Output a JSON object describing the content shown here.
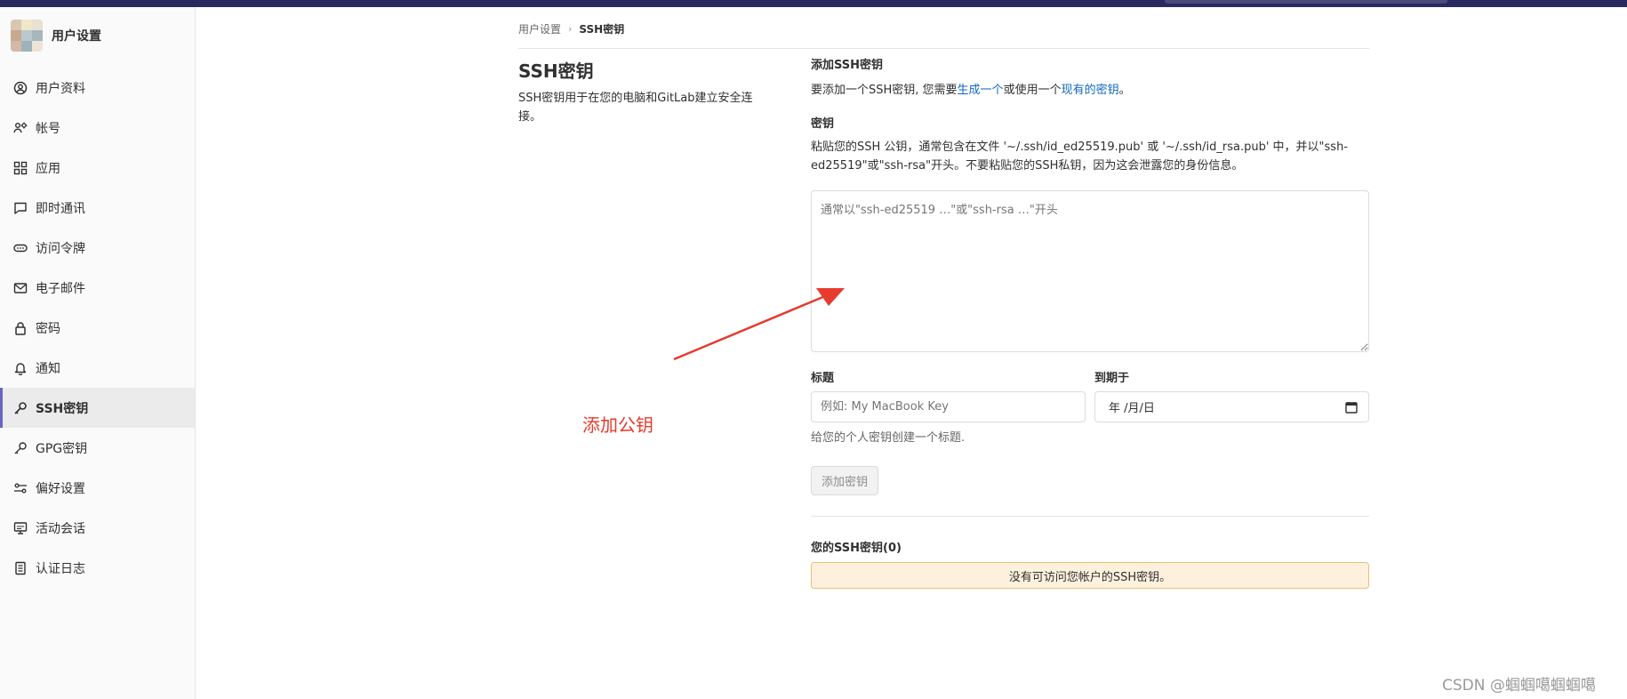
{
  "sidebar": {
    "title": "用户设置",
    "items": [
      {
        "label": "用户资料",
        "icon": "profile-icon"
      },
      {
        "label": "帐号",
        "icon": "account-icon"
      },
      {
        "label": "应用",
        "icon": "applications-icon"
      },
      {
        "label": "即时通讯",
        "icon": "chat-icon"
      },
      {
        "label": "访问令牌",
        "icon": "token-icon"
      },
      {
        "label": "电子邮件",
        "icon": "mail-icon"
      },
      {
        "label": "密码",
        "icon": "lock-icon"
      },
      {
        "label": "通知",
        "icon": "bell-icon"
      },
      {
        "label": "SSH密钥",
        "icon": "key-icon",
        "active": true
      },
      {
        "label": "GPG密钥",
        "icon": "key-icon"
      },
      {
        "label": "偏好设置",
        "icon": "preferences-icon"
      },
      {
        "label": "活动会话",
        "icon": "monitor-icon"
      },
      {
        "label": "认证日志",
        "icon": "log-icon"
      }
    ]
  },
  "breadcrumb": {
    "parent": "用户设置",
    "separator": "›",
    "current": "SSH密钥"
  },
  "intro": {
    "title": "SSH密钥",
    "description": "SSH密钥用于在您的电脑和GitLab建立安全连接。"
  },
  "form": {
    "add_title": "添加SSH密钥",
    "add_text_prefix": "要添加一个SSH密钥, 您需要",
    "add_link_generate": "生成一个",
    "add_text_middle": "或使用一个",
    "add_link_existing": "现有的密钥",
    "add_text_suffix": "。",
    "key_label": "密钥",
    "key_help": "粘贴您的SSH 公钥，通常包含在文件 '~/.ssh/id_ed25519.pub' 或 '~/.ssh/id_rsa.pub' 中，并以\"ssh-ed25519\"或\"ssh-rsa\"开头。不要粘贴您的SSH私钥，因为这会泄露您的身份信息。",
    "key_placeholder": "通常以\"ssh-ed25519 …\"或\"ssh-rsa …\"开头",
    "title_label": "标题",
    "title_placeholder": "例如: My MacBook Key",
    "expires_label": "到期于",
    "expires_value": "年 /月/日",
    "title_hint": "给您的个人密钥创建一个标题.",
    "submit_label": "添加密钥"
  },
  "keys": {
    "title": "您的SSH密钥(0)",
    "empty_message": "没有可访问您帐户的SSH密钥。"
  },
  "annotation": {
    "text": "添加公钥",
    "color": "#e63b2e"
  },
  "watermark": "CSDN @蝈蝈噶蝈蝈噶",
  "colors": {
    "topbar": "#292961",
    "active_indicator": "#6666c4",
    "link": "#1068bf",
    "alert_bg": "#fdf1dd",
    "alert_border": "#e9be74"
  }
}
